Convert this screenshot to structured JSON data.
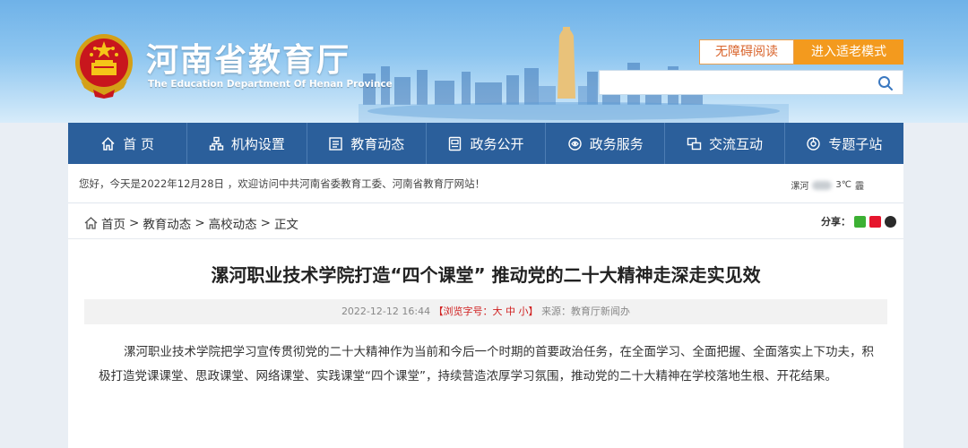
{
  "site": {
    "title_cn": "河南省教育厅",
    "title_en": "The Education Department Of Henan Province"
  },
  "top_buttons": {
    "barrier_free": "无障碍阅读",
    "elder_mode": "进入适老模式"
  },
  "search": {
    "placeholder": ""
  },
  "nav": {
    "items": [
      {
        "label": "首 页",
        "icon": "home-icon"
      },
      {
        "label": "机构设置",
        "icon": "org-chart-icon"
      },
      {
        "label": "教育动态",
        "icon": "news-icon"
      },
      {
        "label": "政务公开",
        "icon": "document-icon"
      },
      {
        "label": "政务服务",
        "icon": "service-icon"
      },
      {
        "label": "交流互动",
        "icon": "interaction-icon"
      },
      {
        "label": "专题子站",
        "icon": "topic-icon"
      }
    ]
  },
  "welcome": {
    "text": "您好，今天是2022年12月28日 ，欢迎访问中共河南省委教育工委、河南省教育厅网站！",
    "weather_city": "漯河",
    "weather_temp": "3℃",
    "weather_cond": "霾"
  },
  "breadcrumb": {
    "home": "首页",
    "sep1": ">",
    "level1": "教育动态",
    "sep2": ">",
    "level2": "高校动态",
    "sep3": ">",
    "current": "正文"
  },
  "share": {
    "label": "分享："
  },
  "article": {
    "title": "漯河职业技术学院打造“四个课堂” 推动党的二十大精神走深走实见效",
    "date": "2022-12-12 16:44",
    "font_size_label": "【浏览字号：大 中 小】",
    "source": "来源：教育厅新闻办",
    "body": "漯河职业技术学院把学习宣传贯彻党的二十大精神作为当前和今后一个时期的首要政治任务，在全面学习、全面把握、全面落实上下功夫，积极打造党课课堂、思政课堂、网络课堂、实践课堂“四个课堂”，持续营造浓厚学习氛围，推动党的二十大精神在学校落地生根、开花结果。"
  },
  "colors": {
    "nav_bg": "#2b5f9b",
    "elder_btn": "#f39a1e",
    "accent_red": "#d02020"
  }
}
